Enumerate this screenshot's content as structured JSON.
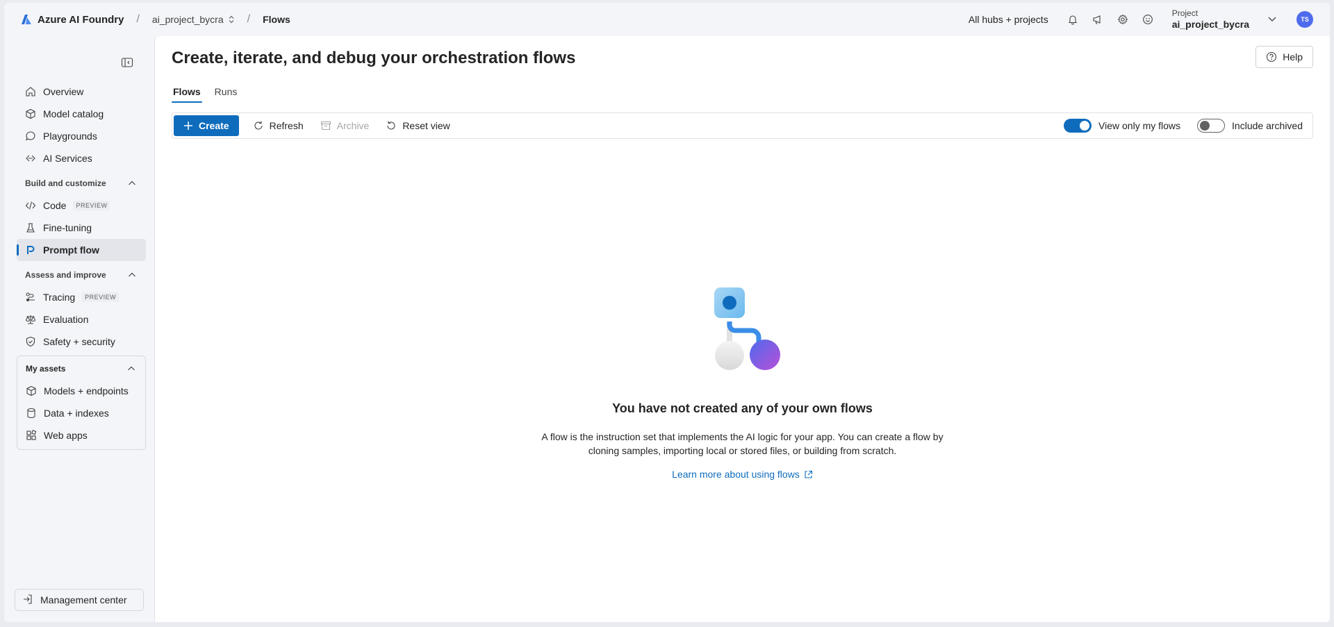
{
  "topbar": {
    "brand": "Azure AI Foundry",
    "project_crumb": "ai_project_bycra",
    "current_crumb": "Flows",
    "hubs_link": "All hubs + projects",
    "project_label": "Project",
    "project_name": "ai_project_bycra",
    "avatar_initials": "TS"
  },
  "sidebar": {
    "items": [
      {
        "label": "Overview",
        "icon": "home-icon"
      },
      {
        "label": "Model catalog",
        "icon": "cube-icon"
      },
      {
        "label": "Playgrounds",
        "icon": "chat-icon"
      },
      {
        "label": "AI Services",
        "icon": "link-icon"
      }
    ],
    "build_section": "Build and customize",
    "build_items": [
      {
        "label": "Code",
        "badge": "PREVIEW",
        "icon": "code-icon"
      },
      {
        "label": "Fine-tuning",
        "icon": "flask-icon"
      },
      {
        "label": "Prompt flow",
        "icon": "prompt-flow-icon",
        "active": true
      }
    ],
    "assess_section": "Assess and improve",
    "assess_items": [
      {
        "label": "Tracing",
        "badge": "PREVIEW",
        "icon": "tracing-icon"
      },
      {
        "label": "Evaluation",
        "icon": "scale-icon"
      },
      {
        "label": "Safety + security",
        "icon": "shield-icon"
      }
    ],
    "assets_section": "My assets",
    "assets_items": [
      {
        "label": "Models + endpoints",
        "icon": "cube-icon"
      },
      {
        "label": "Data + indexes",
        "icon": "database-icon"
      },
      {
        "label": "Web apps",
        "icon": "apps-icon"
      }
    ],
    "management": "Management center"
  },
  "main": {
    "title": "Create, iterate, and debug your orchestration flows",
    "help": "Help",
    "tabs": [
      "Flows",
      "Runs"
    ],
    "toolbar": {
      "create": "Create",
      "refresh": "Refresh",
      "archive": "Archive",
      "reset": "Reset view",
      "view_only_mine": "View only my flows",
      "include_archived": "Include archived"
    },
    "empty": {
      "title": "You have not created any of your own flows",
      "desc_line1": "A flow is the instruction set that implements the AI logic for your app. You can create a flow by",
      "desc_line2": "cloning samples, importing local or stored files, or building from scratch.",
      "link": "Learn more about using flows"
    }
  },
  "colors": {
    "accent": "#0f6cbd",
    "avatar": "#4f6bed",
    "sidebar_bg": "#f4f5f8"
  }
}
